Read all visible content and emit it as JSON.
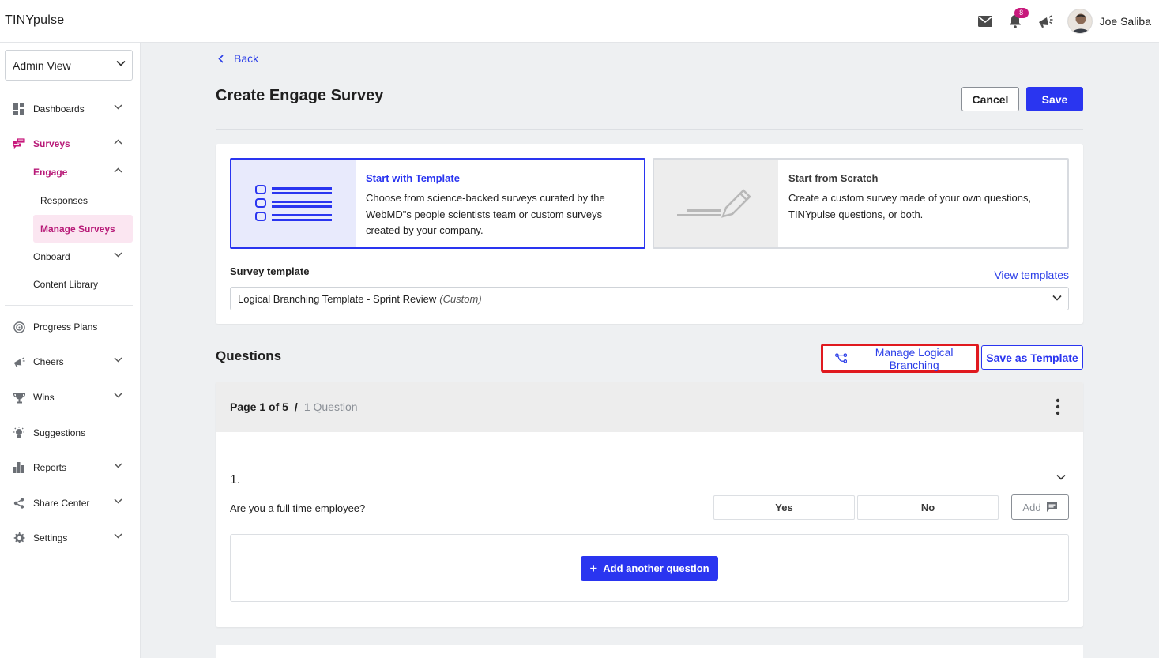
{
  "header": {
    "brand": "TINYpulse",
    "notification_count": "8",
    "user_name": "Joe Saliba"
  },
  "sidebar": {
    "view_selector": "Admin View",
    "items": [
      {
        "label": "Dashboards"
      },
      {
        "label": "Surveys"
      },
      {
        "label": "Engage"
      },
      {
        "label": "Responses"
      },
      {
        "label": "Manage Surveys"
      },
      {
        "label": "Onboard"
      },
      {
        "label": "Content Library"
      },
      {
        "label": "Progress Plans"
      },
      {
        "label": "Cheers"
      },
      {
        "label": "Wins"
      },
      {
        "label": "Suggestions"
      },
      {
        "label": "Reports"
      },
      {
        "label": "Share Center"
      },
      {
        "label": "Settings"
      }
    ]
  },
  "main": {
    "back_label": "Back",
    "title": "Create Engage Survey",
    "cancel_label": "Cancel",
    "save_label": "Save",
    "options": {
      "template": {
        "title": "Start with Template",
        "description": "Choose from science-backed surveys curated by the WebMD\"s people scientists team or custom surveys created by your company."
      },
      "scratch": {
        "title": "Start from Scratch",
        "description": "Create a custom survey made of your own questions, TINYpulse questions, or both."
      }
    },
    "survey_template_label": "Survey template",
    "view_templates_label": "View templates",
    "selected_template": "Logical Branching Template - Sprint Review",
    "selected_template_tag": "(Custom)",
    "questions_heading": "Questions",
    "manage_branching_label": "Manage Logical Branching",
    "save_as_template_label": "Save as Template",
    "page": {
      "label": "Page 1 of 5",
      "separator": "/",
      "question_count": "1 Question"
    },
    "question": {
      "number": "1.",
      "text": "Are you a full time employee?",
      "answers": [
        "Yes",
        "No"
      ],
      "add_label": "Add"
    },
    "add_another_label": "Add another question"
  },
  "colors": {
    "accent": "#2a35f0",
    "brand_pink": "#b81a78",
    "highlight_red": "#e0191f"
  }
}
